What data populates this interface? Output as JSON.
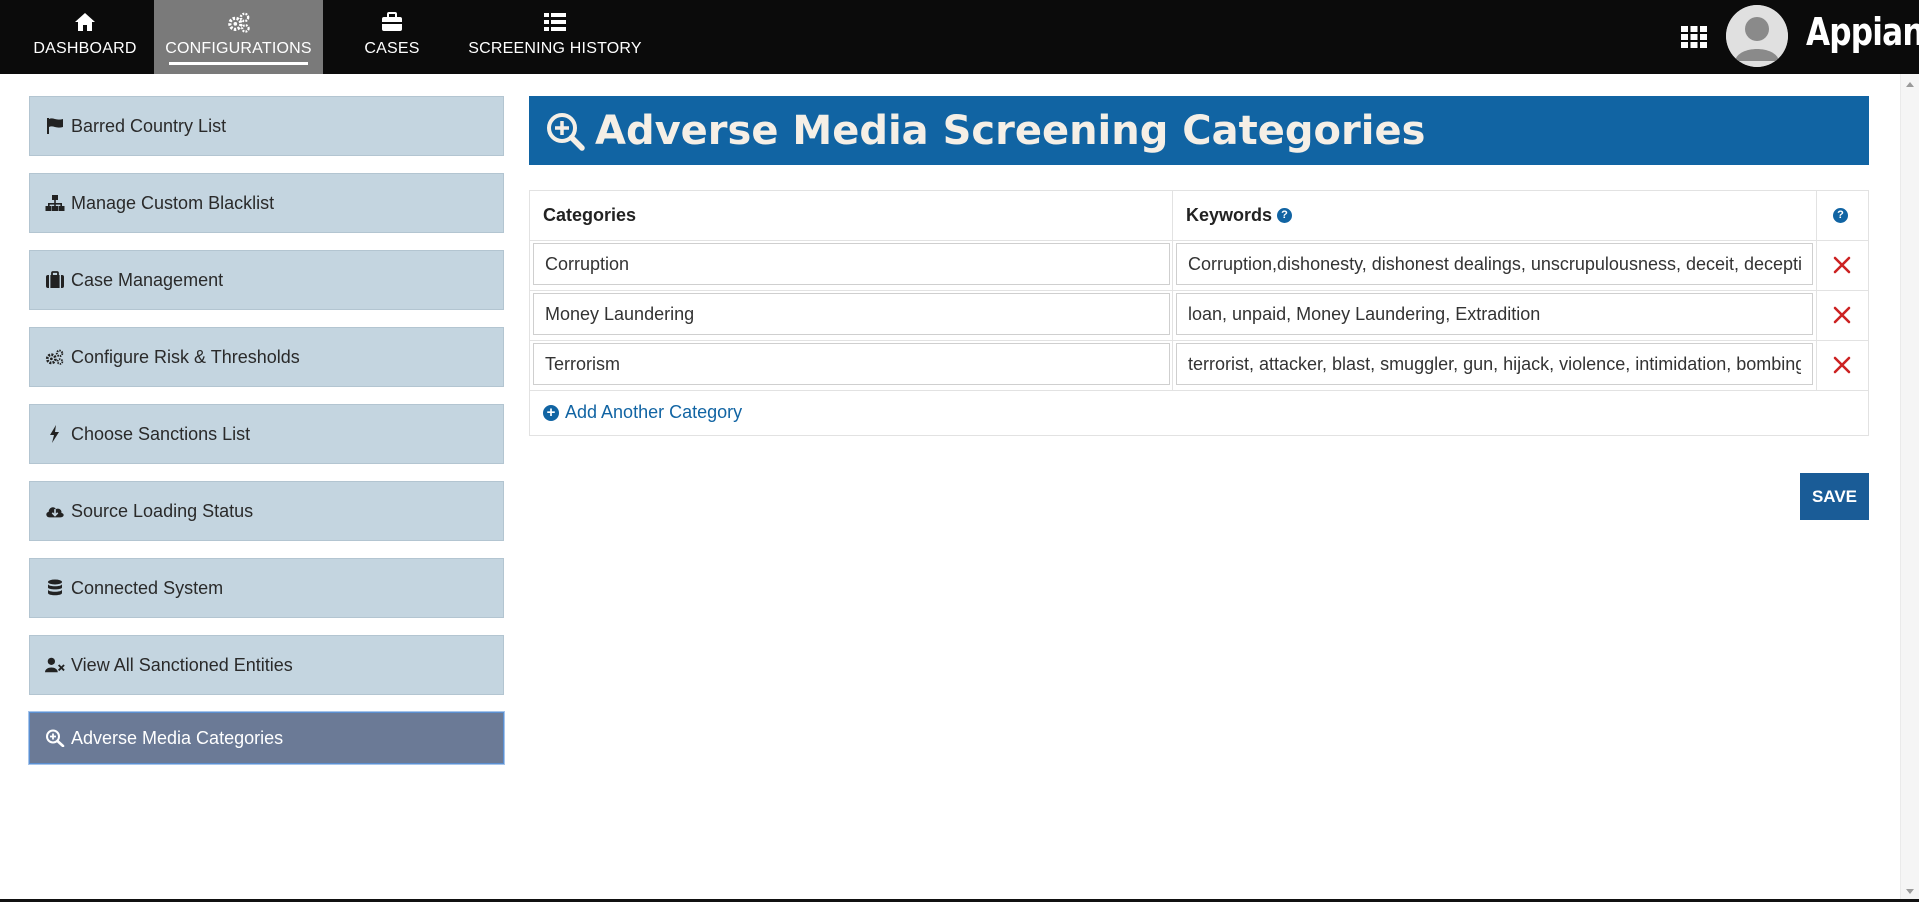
{
  "nav": {
    "tabs": [
      {
        "label": "DASHBOARD",
        "icon": "home-icon"
      },
      {
        "label": "CONFIGURATIONS",
        "icon": "gears-icon",
        "active": true
      },
      {
        "label": "CASES",
        "icon": "briefcase-icon"
      },
      {
        "label": "SCREENING HISTORY",
        "icon": "list-icon"
      }
    ],
    "brand": "Appian",
    "apps_icon": "grid-icon",
    "avatar_icon": "user-avatar-icon"
  },
  "sidebar": {
    "items": [
      {
        "label": "Barred Country List",
        "icon": "flag-icon"
      },
      {
        "label": "Manage Custom Blacklist",
        "icon": "sitemap-icon"
      },
      {
        "label": "Case Management",
        "icon": "briefcase-icon"
      },
      {
        "label": "Configure Risk & Thresholds",
        "icon": "gears-icon"
      },
      {
        "label": "Choose Sanctions List",
        "icon": "bolt-icon"
      },
      {
        "label": "Source Loading Status",
        "icon": "cloud-download-icon"
      },
      {
        "label": "Connected System",
        "icon": "database-icon"
      },
      {
        "label": "View All Sanctioned Entities",
        "icon": "user-times-icon"
      },
      {
        "label": "Adverse Media Categories",
        "icon": "search-plus-icon",
        "active": true
      }
    ]
  },
  "main": {
    "title": "Adverse Media Screening Categories",
    "title_icon": "search-plus-icon",
    "table": {
      "headers": {
        "categories": "Categories",
        "keywords": "Keywords"
      },
      "rows": [
        {
          "category": "Corruption",
          "keywords": "Corruption,dishonesty, dishonest dealings, unscrupulousness, deceit, deception"
        },
        {
          "category": "Money Laundering",
          "keywords": "loan, unpaid, Money Laundering, Extradition"
        },
        {
          "category": "Terrorism",
          "keywords": "terrorist, attacker, blast, smuggler, gun, hijack, violence, intimidation, bombing"
        }
      ]
    },
    "add_label": "Add Another Category",
    "save_label": "SAVE"
  },
  "colors": {
    "nav_bg": "#0b0b0b",
    "header_bg": "#1164a3",
    "sidebar_bg": "#c4d5e0",
    "sidebar_active_bg": "#6b7a96",
    "delete_red": "#cc2222"
  }
}
